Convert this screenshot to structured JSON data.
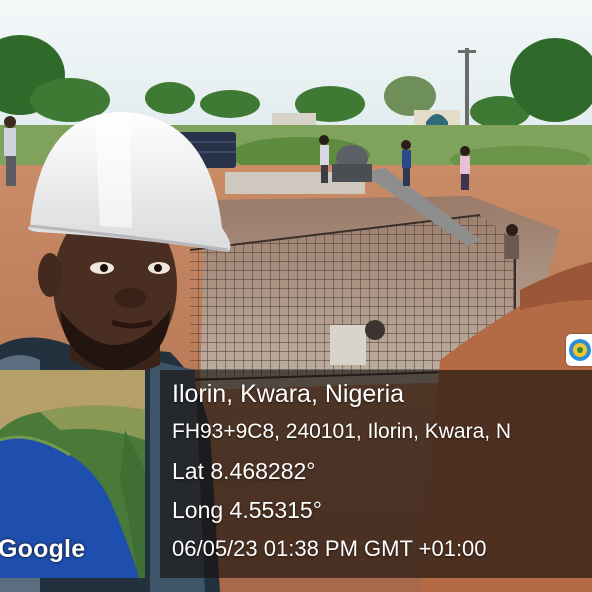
{
  "photo": {
    "description_icon": "construction-site-selfie-photo"
  },
  "geotag": {
    "place": "Ilorin, Kwara, Nigeria",
    "address_line": "FH93+9C8, 240101, Ilorin, Kwara, N",
    "latitude": "Lat 8.468282°",
    "longitude": "Long 4.55315°",
    "datetime": "06/05/23 01:38 PM GMT +01:00",
    "map_logo": "Google"
  },
  "colors": {
    "panel_bg": "#18120e",
    "text": "#ffffff",
    "map_land": "#4a7a3a",
    "map_water": "#1f4fae"
  },
  "icons": {
    "map_pin": "map-pin-icon"
  }
}
